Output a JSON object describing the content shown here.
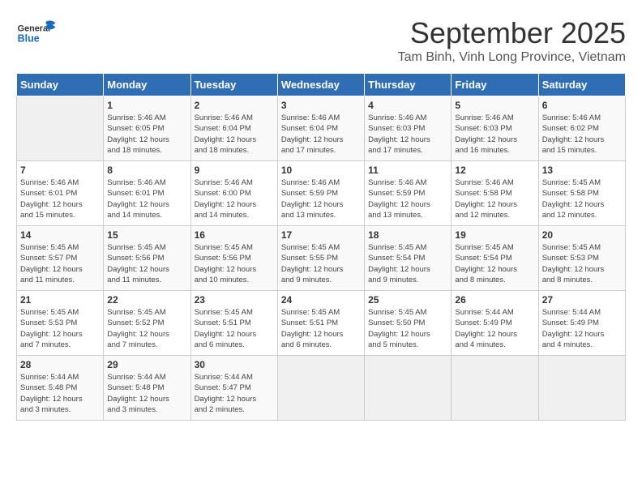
{
  "header": {
    "logo_general": "General",
    "logo_blue": "Blue",
    "month_year": "September 2025",
    "location": "Tam Binh, Vinh Long Province, Vietnam"
  },
  "days_of_week": [
    "Sunday",
    "Monday",
    "Tuesday",
    "Wednesday",
    "Thursday",
    "Friday",
    "Saturday"
  ],
  "weeks": [
    [
      {
        "day": "",
        "info": ""
      },
      {
        "day": "1",
        "info": "Sunrise: 5:46 AM\nSunset: 6:05 PM\nDaylight: 12 hours\nand 18 minutes."
      },
      {
        "day": "2",
        "info": "Sunrise: 5:46 AM\nSunset: 6:04 PM\nDaylight: 12 hours\nand 18 minutes."
      },
      {
        "day": "3",
        "info": "Sunrise: 5:46 AM\nSunset: 6:04 PM\nDaylight: 12 hours\nand 17 minutes."
      },
      {
        "day": "4",
        "info": "Sunrise: 5:46 AM\nSunset: 6:03 PM\nDaylight: 12 hours\nand 17 minutes."
      },
      {
        "day": "5",
        "info": "Sunrise: 5:46 AM\nSunset: 6:03 PM\nDaylight: 12 hours\nand 16 minutes."
      },
      {
        "day": "6",
        "info": "Sunrise: 5:46 AM\nSunset: 6:02 PM\nDaylight: 12 hours\nand 15 minutes."
      }
    ],
    [
      {
        "day": "7",
        "info": "Sunrise: 5:46 AM\nSunset: 6:01 PM\nDaylight: 12 hours\nand 15 minutes."
      },
      {
        "day": "8",
        "info": "Sunrise: 5:46 AM\nSunset: 6:01 PM\nDaylight: 12 hours\nand 14 minutes."
      },
      {
        "day": "9",
        "info": "Sunrise: 5:46 AM\nSunset: 6:00 PM\nDaylight: 12 hours\nand 14 minutes."
      },
      {
        "day": "10",
        "info": "Sunrise: 5:46 AM\nSunset: 5:59 PM\nDaylight: 12 hours\nand 13 minutes."
      },
      {
        "day": "11",
        "info": "Sunrise: 5:46 AM\nSunset: 5:59 PM\nDaylight: 12 hours\nand 13 minutes."
      },
      {
        "day": "12",
        "info": "Sunrise: 5:46 AM\nSunset: 5:58 PM\nDaylight: 12 hours\nand 12 minutes."
      },
      {
        "day": "13",
        "info": "Sunrise: 5:45 AM\nSunset: 5:58 PM\nDaylight: 12 hours\nand 12 minutes."
      }
    ],
    [
      {
        "day": "14",
        "info": "Sunrise: 5:45 AM\nSunset: 5:57 PM\nDaylight: 12 hours\nand 11 minutes."
      },
      {
        "day": "15",
        "info": "Sunrise: 5:45 AM\nSunset: 5:56 PM\nDaylight: 12 hours\nand 11 minutes."
      },
      {
        "day": "16",
        "info": "Sunrise: 5:45 AM\nSunset: 5:56 PM\nDaylight: 12 hours\nand 10 minutes."
      },
      {
        "day": "17",
        "info": "Sunrise: 5:45 AM\nSunset: 5:55 PM\nDaylight: 12 hours\nand 9 minutes."
      },
      {
        "day": "18",
        "info": "Sunrise: 5:45 AM\nSunset: 5:54 PM\nDaylight: 12 hours\nand 9 minutes."
      },
      {
        "day": "19",
        "info": "Sunrise: 5:45 AM\nSunset: 5:54 PM\nDaylight: 12 hours\nand 8 minutes."
      },
      {
        "day": "20",
        "info": "Sunrise: 5:45 AM\nSunset: 5:53 PM\nDaylight: 12 hours\nand 8 minutes."
      }
    ],
    [
      {
        "day": "21",
        "info": "Sunrise: 5:45 AM\nSunset: 5:53 PM\nDaylight: 12 hours\nand 7 minutes."
      },
      {
        "day": "22",
        "info": "Sunrise: 5:45 AM\nSunset: 5:52 PM\nDaylight: 12 hours\nand 7 minutes."
      },
      {
        "day": "23",
        "info": "Sunrise: 5:45 AM\nSunset: 5:51 PM\nDaylight: 12 hours\nand 6 minutes."
      },
      {
        "day": "24",
        "info": "Sunrise: 5:45 AM\nSunset: 5:51 PM\nDaylight: 12 hours\nand 6 minutes."
      },
      {
        "day": "25",
        "info": "Sunrise: 5:45 AM\nSunset: 5:50 PM\nDaylight: 12 hours\nand 5 minutes."
      },
      {
        "day": "26",
        "info": "Sunrise: 5:44 AM\nSunset: 5:49 PM\nDaylight: 12 hours\nand 4 minutes."
      },
      {
        "day": "27",
        "info": "Sunrise: 5:44 AM\nSunset: 5:49 PM\nDaylight: 12 hours\nand 4 minutes."
      }
    ],
    [
      {
        "day": "28",
        "info": "Sunrise: 5:44 AM\nSunset: 5:48 PM\nDaylight: 12 hours\nand 3 minutes."
      },
      {
        "day": "29",
        "info": "Sunrise: 5:44 AM\nSunset: 5:48 PM\nDaylight: 12 hours\nand 3 minutes."
      },
      {
        "day": "30",
        "info": "Sunrise: 5:44 AM\nSunset: 5:47 PM\nDaylight: 12 hours\nand 2 minutes."
      },
      {
        "day": "",
        "info": ""
      },
      {
        "day": "",
        "info": ""
      },
      {
        "day": "",
        "info": ""
      },
      {
        "day": "",
        "info": ""
      }
    ]
  ]
}
